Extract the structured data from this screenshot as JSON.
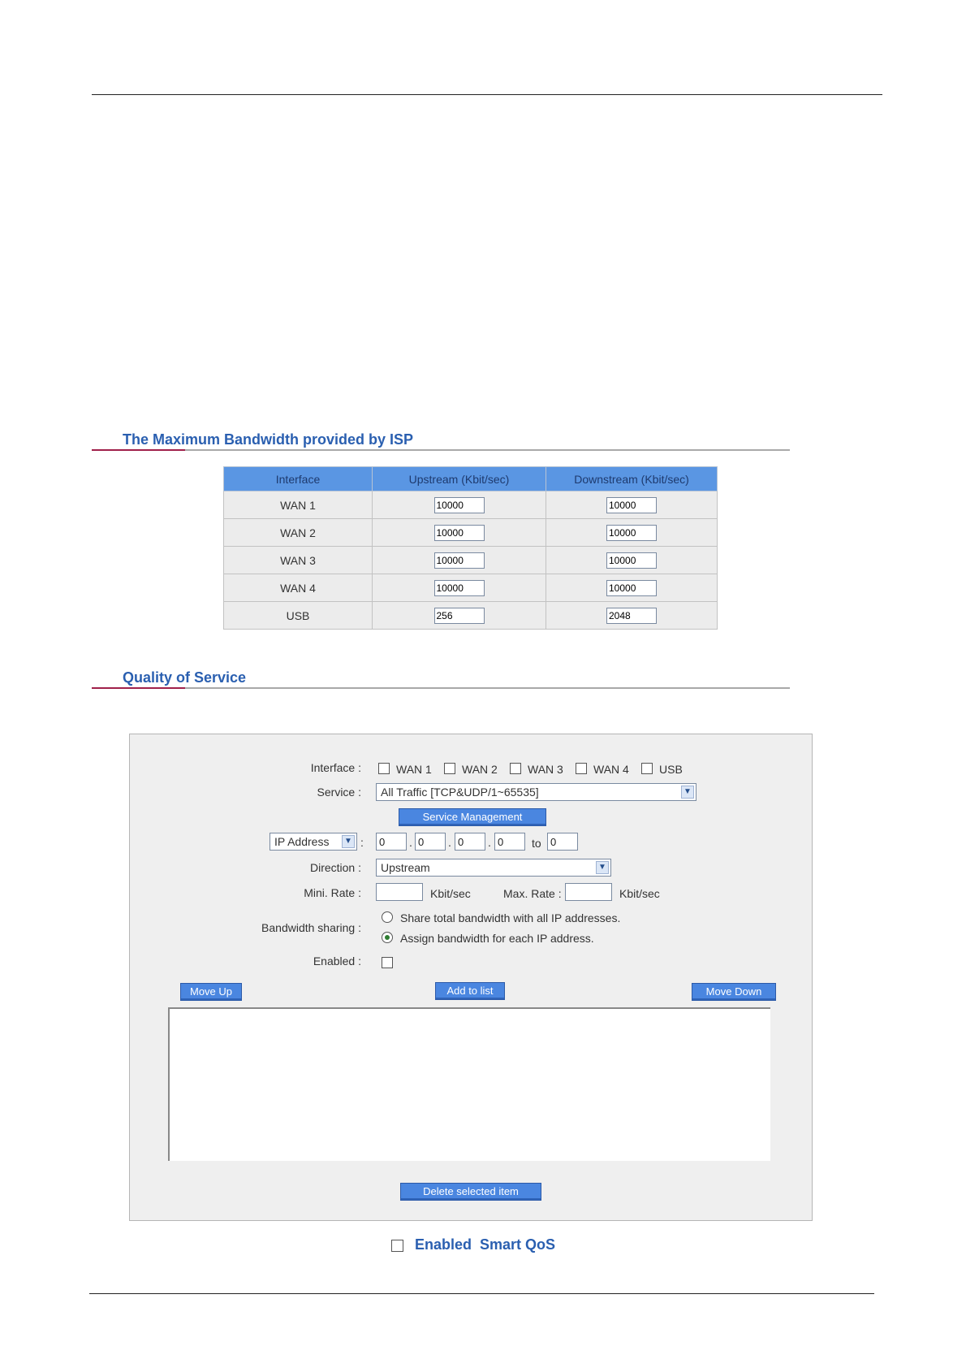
{
  "isp_section": {
    "title": "The Maximum Bandwidth provided by ISP",
    "headers": [
      "Interface",
      "Upstream (Kbit/sec)",
      "Downstream (Kbit/sec)"
    ],
    "rows": [
      {
        "interface": "WAN 1",
        "upstream": "10000",
        "downstream": "10000"
      },
      {
        "interface": "WAN 2",
        "upstream": "10000",
        "downstream": "10000"
      },
      {
        "interface": "WAN 3",
        "upstream": "10000",
        "downstream": "10000"
      },
      {
        "interface": "WAN 4",
        "upstream": "10000",
        "downstream": "10000"
      },
      {
        "interface": "USB",
        "upstream": "256",
        "downstream": "2048"
      }
    ]
  },
  "qos_section": {
    "title": "Quality of Service",
    "interface_label": "Interface :",
    "interfaces": [
      "WAN 1",
      "WAN 2",
      "WAN 3",
      "WAN 4",
      "USB"
    ],
    "service_label": "Service :",
    "service_value": "All Traffic [TCP&UDP/1~65535]",
    "service_management_button": "Service Management",
    "address_type": "IP Address",
    "address_colon": ":",
    "ip_from": [
      "0",
      "0",
      "0",
      "0"
    ],
    "ip_dot": ".",
    "to_label": "to",
    "ip_to": "0",
    "direction_label": "Direction :",
    "direction_value": "Upstream",
    "mini_rate_label": "Mini. Rate :",
    "unit": "Kbit/sec",
    "max_rate_label": "Max. Rate :",
    "sharing_label": "Bandwidth sharing :",
    "sharing_options": [
      "Share total bandwidth with all IP addresses.",
      "Assign bandwidth for each IP address."
    ],
    "sharing_selected_index": 1,
    "enabled_label": "Enabled :",
    "move_up_button": "Move Up",
    "add_button": "Add to list",
    "move_down_button": "Move Down",
    "delete_button": "Delete selected item"
  },
  "smart_qos": {
    "enabled_label": "Enabled",
    "name": "Smart QoS"
  }
}
